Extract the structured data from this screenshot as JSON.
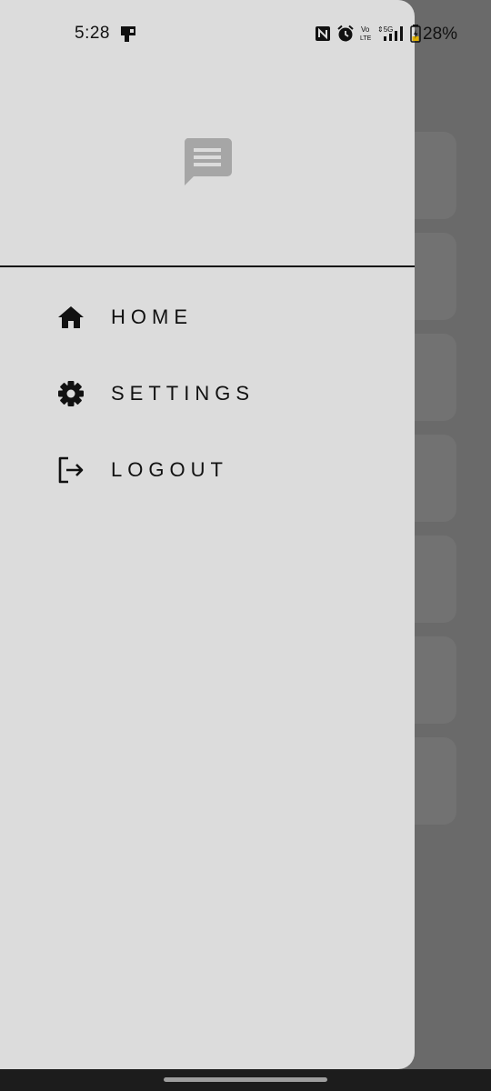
{
  "status_bar": {
    "time": "5:28",
    "battery_text": "28%",
    "network_label": "5G",
    "volte_label": "Vo LTE"
  },
  "drawer": {
    "header_icon": "chat-message-icon",
    "menu": [
      {
        "label": "HOME",
        "icon": "home-icon"
      },
      {
        "label": "SETTINGS",
        "icon": "gear-icon"
      },
      {
        "label": "LOGOUT",
        "icon": "logout-icon"
      }
    ]
  },
  "colors": {
    "drawer_bg": "#dcdcdc",
    "scrim": "#6a6a6a",
    "text": "#111111",
    "header_icon": "#a6a6a6"
  }
}
